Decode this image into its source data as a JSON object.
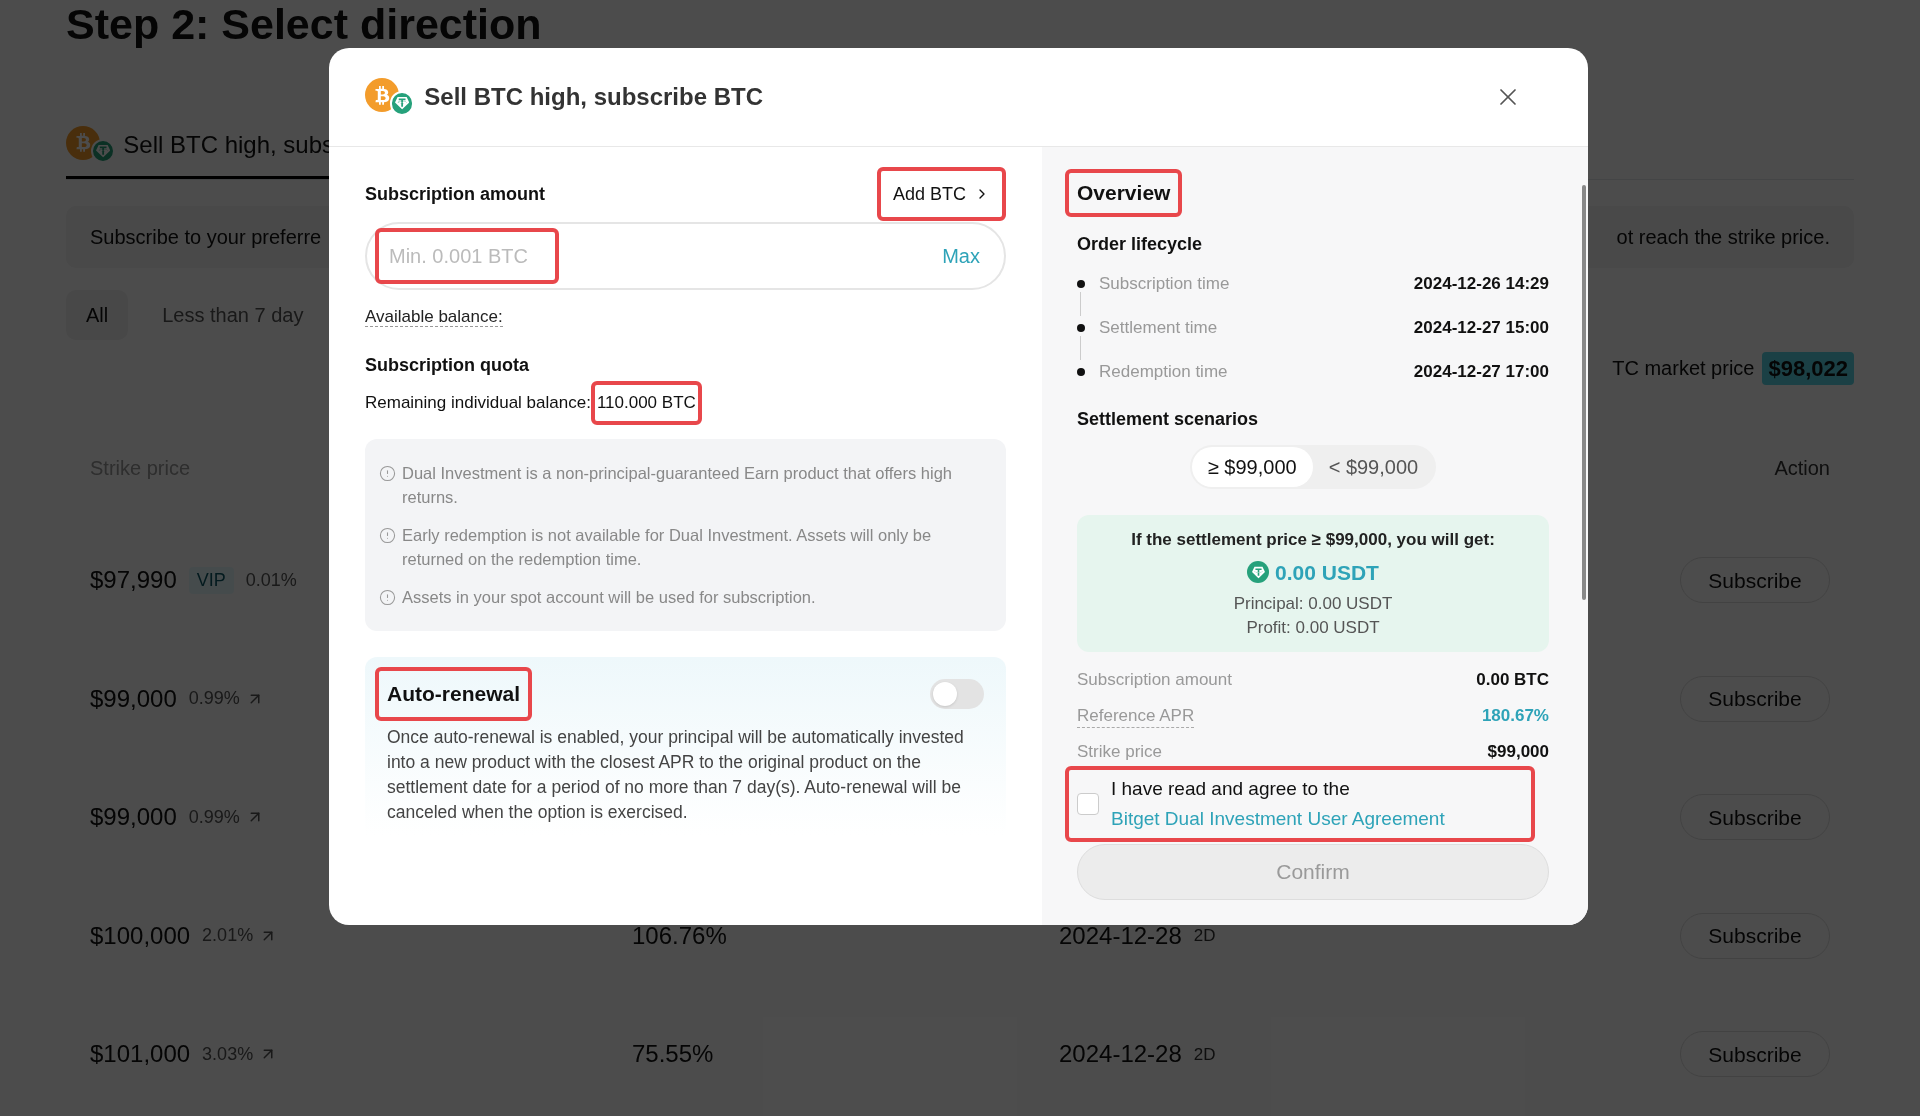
{
  "background": {
    "title": "Step 2: Select direction",
    "tab": {
      "label": "Sell BTC high, subs",
      "selected": true
    },
    "notice": {
      "left": "Subscribe to your preferre",
      "right": "ot reach the strike price."
    },
    "filters": [
      {
        "label": "All",
        "selected": true
      },
      {
        "label": "Less than 7 day",
        "selected": false
      }
    ],
    "market_price": {
      "label": "TC market price",
      "value": "$98,022"
    },
    "table": {
      "columns": [
        "Strike price",
        "Action"
      ],
      "rows": [
        {
          "strike": "$97,990",
          "badge": "VIP",
          "change": "0.01%",
          "trend_arrow": false,
          "action": "Subscribe"
        },
        {
          "strike": "$99,000",
          "change": "0.99%",
          "trend_arrow": true,
          "action": "Subscribe"
        },
        {
          "strike": "$99,000",
          "change": "0.99%",
          "trend_arrow": true,
          "action": "Subscribe"
        },
        {
          "strike": "$100,000",
          "change": "2.01%",
          "trend_arrow": true,
          "apr": "106.76%",
          "date": "2024-12-28",
          "term": "2D",
          "action": "Subscribe"
        },
        {
          "strike": "$101,000",
          "change": "3.03%",
          "trend_arrow": true,
          "apr": "75.55%",
          "date": "2024-12-28",
          "term": "2D",
          "action": "Subscribe"
        }
      ]
    }
  },
  "modal": {
    "title": "Sell BTC high, subscribe BTC",
    "amount": {
      "label": "Subscription amount",
      "add_button": {
        "label": "Add BTC",
        "highlighted": true
      },
      "input": {
        "placeholder": "Min. 0.001 BTC",
        "highlighted": true
      },
      "max": "Max",
      "available": "Available balance:"
    },
    "quota": {
      "label": "Subscription quota",
      "remaining_label": "Remaining individual balance:",
      "remaining_value": "110.000 BTC",
      "highlighted": true
    },
    "notes": [
      "Dual Investment is a non-principal-guaranteed Earn product that offers high returns.",
      "Early redemption is not available for Dual Investment. Assets will only be returned on the redemption time.",
      "Assets in your spot account will be used for subscription."
    ],
    "auto_renewal": {
      "title": "Auto-renewal",
      "highlighted": true,
      "on": false,
      "description": "Once auto-renewal is enabled, your principal will be automatically invested into a new product with the closest APR to the original product on the settlement date for a period of no more than 7 day(s). Auto-renewal will be canceled when the option is exercised."
    },
    "overview": {
      "title": "Overview",
      "highlighted": true,
      "lifecycle_title": "Order lifecycle",
      "lifecycle": [
        {
          "label": "Subscription time",
          "value": "2024-12-26 14:29"
        },
        {
          "label": "Settlement time",
          "value": "2024-12-27 15:00"
        },
        {
          "label": "Redemption time",
          "value": "2024-12-27 17:00"
        }
      ],
      "scenarios_title": "Settlement scenarios",
      "scenarios": [
        {
          "label": "≥ $99,000",
          "selected": true
        },
        {
          "label": "< $99,000",
          "selected": false
        }
      ],
      "result": {
        "heading": "If the settlement price ≥ $99,000, you will get:",
        "amount": "0.00 USDT",
        "principal": "Principal: 0.00 USDT",
        "profit": "Profit: 0.00 USDT"
      },
      "details": [
        {
          "label": "Subscription amount",
          "value": "0.00 BTC",
          "kind": "plain"
        },
        {
          "label": "Reference APR",
          "value": "180.67%",
          "kind": "apr"
        },
        {
          "label": "Strike price",
          "value": "$99,000",
          "kind": "plain"
        }
      ],
      "agreement": {
        "text": "I have read and agree to the",
        "link": "Bitget Dual Investment User Agreement",
        "checked": false,
        "highlighted": true
      },
      "confirm": {
        "label": "Confirm",
        "disabled": true
      }
    }
  }
}
